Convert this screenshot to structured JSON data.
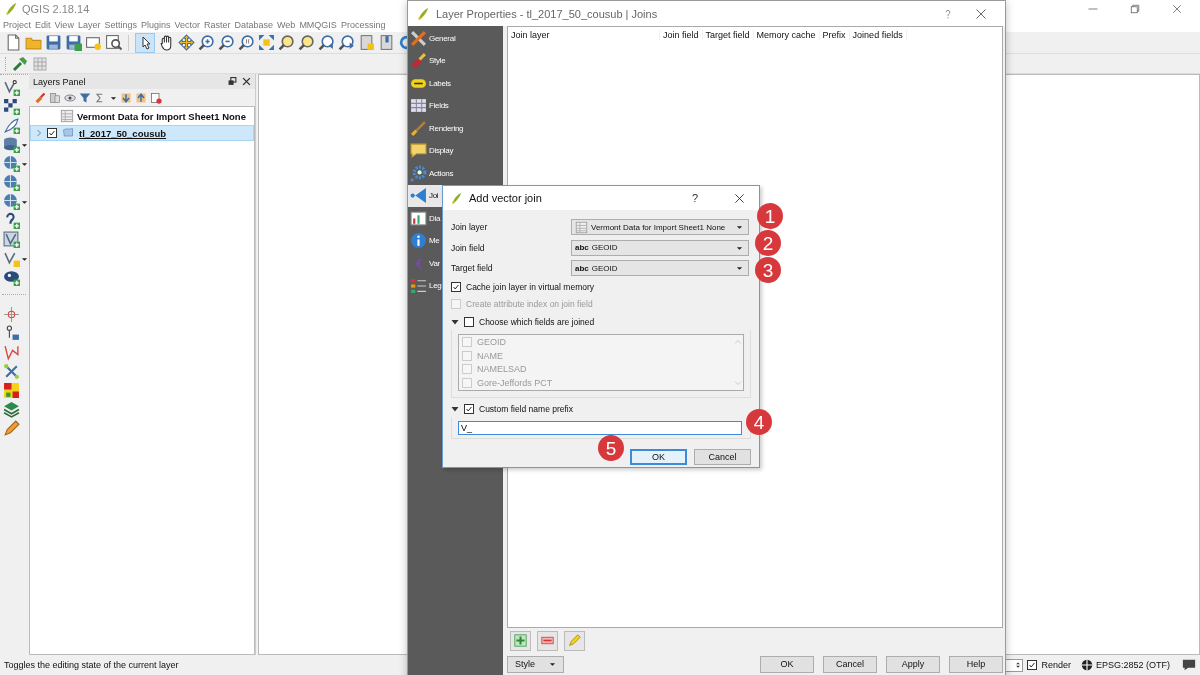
{
  "app": {
    "title": "QGIS 2.18.14"
  },
  "menu": [
    "Project",
    "Edit",
    "View",
    "Layer",
    "Settings",
    "Plugins",
    "Vector",
    "Raster",
    "Database",
    "Web",
    "MMQGIS",
    "Processing"
  ],
  "layers_panel": {
    "title": "Layers Panel",
    "layers": [
      {
        "name": "Vermont Data for Import Sheet1 None",
        "kind": "table",
        "selected": false
      },
      {
        "name": "tl_2017_50_cousub",
        "kind": "vector",
        "checked": true,
        "selected": true
      }
    ]
  },
  "status_bar": {
    "message": "Toggles the editing state of the current layer",
    "render_label": "Render",
    "render_checked": true,
    "crs": "EPSG:2852 (OTF)"
  },
  "layer_properties": {
    "title": "Layer Properties - tl_2017_50_cousub | Joins",
    "sections": [
      {
        "label": "General",
        "selected": false
      },
      {
        "label": "Style",
        "selected": false
      },
      {
        "label": "Labels",
        "selected": false
      },
      {
        "label": "Fields",
        "selected": false
      },
      {
        "label": "Rendering",
        "selected": false
      },
      {
        "label": "Display",
        "selected": false
      },
      {
        "label": "Actions",
        "selected": false
      },
      {
        "label": "Joi",
        "selected": true
      },
      {
        "label": "Dia",
        "selected": false
      },
      {
        "label": "Me",
        "selected": false
      },
      {
        "label": "Var",
        "selected": false
      },
      {
        "label": "Leg",
        "selected": false
      }
    ],
    "joins_table": {
      "columns": [
        "Join layer",
        "Join field",
        "Target field",
        "Memory cache",
        "Prefix",
        "Joined fields"
      ]
    },
    "style_button": "Style",
    "buttons": [
      "OK",
      "Cancel",
      "Apply",
      "Help"
    ]
  },
  "add_vector_join": {
    "title": "Add vector join",
    "help": "?",
    "fields": [
      {
        "label": "Join layer",
        "kind": "layer",
        "value": "Vermont Data for Import Sheet1 None"
      },
      {
        "label": "Join field",
        "kind": "field",
        "type": "abc",
        "value": "GEOID"
      },
      {
        "label": "Target field",
        "kind": "field",
        "type": "abc",
        "value": "GEOID"
      }
    ],
    "options": [
      {
        "label": "Cache join layer in virtual memory",
        "checked": true,
        "disabled": false
      },
      {
        "label": "Create attribute index on join field",
        "checked": false,
        "disabled": true
      }
    ],
    "choose_fields": {
      "label": "Choose which fields are joined",
      "checked": false,
      "expanded": true,
      "items": [
        {
          "label": "GEOID",
          "checked": false
        },
        {
          "label": "NAME",
          "checked": false
        },
        {
          "label": "NAMELSAD",
          "checked": false
        },
        {
          "label": "Gore-Jeffords PCT",
          "checked": false
        }
      ]
    },
    "prefix": {
      "label": "Custom field name prefix",
      "checked": true,
      "expanded": true,
      "value": "V_"
    },
    "buttons": [
      {
        "label": "OK",
        "default": true
      },
      {
        "label": "Cancel",
        "default": false
      }
    ]
  },
  "callouts": [
    "1",
    "2",
    "3",
    "4",
    "5"
  ]
}
